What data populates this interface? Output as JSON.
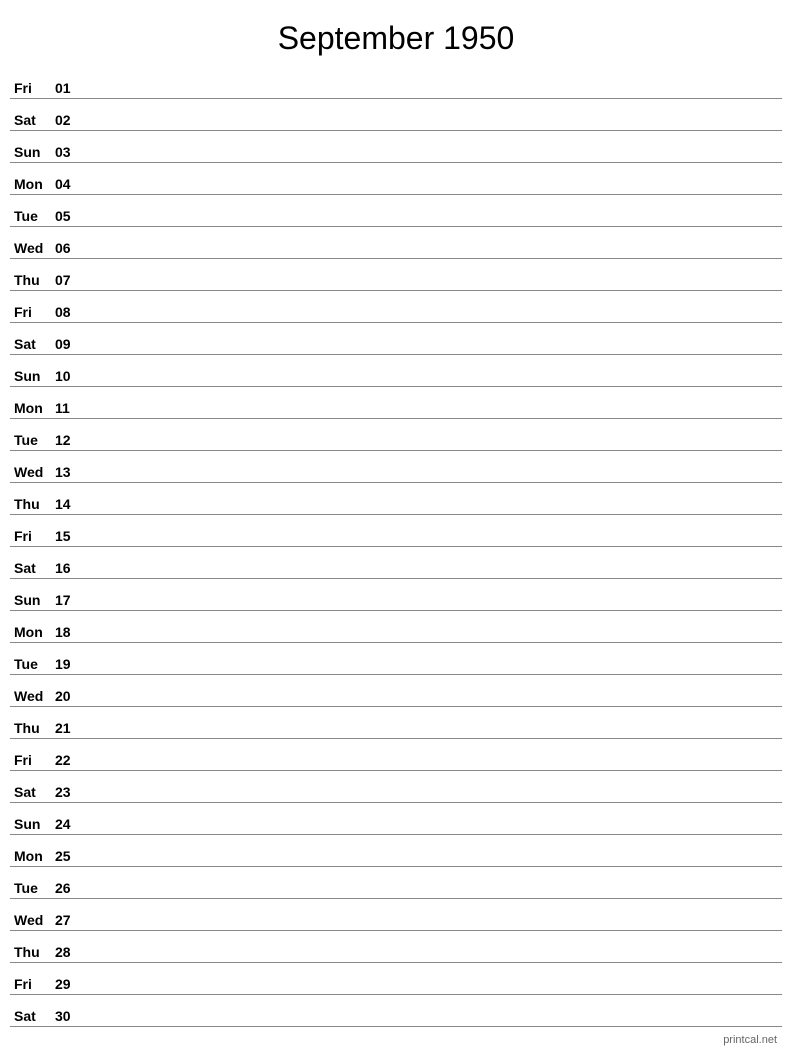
{
  "title": "September 1950",
  "footer": "printcal.net",
  "days": [
    {
      "name": "Fri",
      "number": "01"
    },
    {
      "name": "Sat",
      "number": "02"
    },
    {
      "name": "Sun",
      "number": "03"
    },
    {
      "name": "Mon",
      "number": "04"
    },
    {
      "name": "Tue",
      "number": "05"
    },
    {
      "name": "Wed",
      "number": "06"
    },
    {
      "name": "Thu",
      "number": "07"
    },
    {
      "name": "Fri",
      "number": "08"
    },
    {
      "name": "Sat",
      "number": "09"
    },
    {
      "name": "Sun",
      "number": "10"
    },
    {
      "name": "Mon",
      "number": "11"
    },
    {
      "name": "Tue",
      "number": "12"
    },
    {
      "name": "Wed",
      "number": "13"
    },
    {
      "name": "Thu",
      "number": "14"
    },
    {
      "name": "Fri",
      "number": "15"
    },
    {
      "name": "Sat",
      "number": "16"
    },
    {
      "name": "Sun",
      "number": "17"
    },
    {
      "name": "Mon",
      "number": "18"
    },
    {
      "name": "Tue",
      "number": "19"
    },
    {
      "name": "Wed",
      "number": "20"
    },
    {
      "name": "Thu",
      "number": "21"
    },
    {
      "name": "Fri",
      "number": "22"
    },
    {
      "name": "Sat",
      "number": "23"
    },
    {
      "name": "Sun",
      "number": "24"
    },
    {
      "name": "Mon",
      "number": "25"
    },
    {
      "name": "Tue",
      "number": "26"
    },
    {
      "name": "Wed",
      "number": "27"
    },
    {
      "name": "Thu",
      "number": "28"
    },
    {
      "name": "Fri",
      "number": "29"
    },
    {
      "name": "Sat",
      "number": "30"
    }
  ]
}
